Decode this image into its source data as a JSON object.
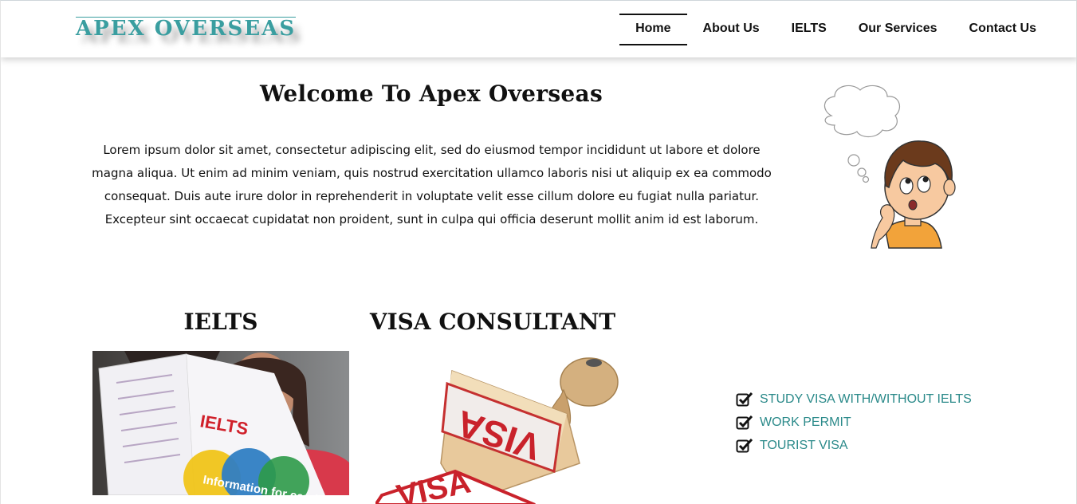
{
  "brand": {
    "logo_text": "APEX OVERSEAS",
    "accent": "#3a9ea0"
  },
  "nav": {
    "items": [
      {
        "label": "Home",
        "active": true
      },
      {
        "label": "About Us",
        "active": false
      },
      {
        "label": "IELTS",
        "active": false
      },
      {
        "label": "Our Services",
        "active": false
      },
      {
        "label": "Contact Us",
        "active": false
      }
    ]
  },
  "welcome": {
    "title": "Welcome To Apex Overseas",
    "text": "Lorem ipsum dolor sit amet, consectetur adipiscing elit, sed do eiusmod tempor incididunt ut labore et dolore magna aliqua. Ut enim ad minim veniam, quis nostrud exercitation ullamco laboris nisi ut aliquip ex ea commodo consequat. Duis aute irure dolor in reprehenderit in voluptate velit esse cillum dolore eu fugiat nulla pariatur. Excepteur sint occaecat cupidatat non proident, sunt in culpa qui officia deserunt mollit anim id est laborum."
  },
  "sections": {
    "ielts": {
      "title": "IELTS",
      "booklet_logo": "IELTS",
      "booklet_caption": "Information for candid"
    },
    "visa": {
      "title": "VISA CONSULTANT",
      "stamp_text": "VISA"
    }
  },
  "services": {
    "items": [
      {
        "label": "STUDY VISA WITH/WITHOUT IELTS",
        "icon": "check-square-icon"
      },
      {
        "label": "WORK PERMIT",
        "icon": "check-square-icon"
      },
      {
        "label": "TOURIST VISA",
        "icon": "check-square-icon"
      }
    ],
    "color": "#2b8a8a"
  }
}
